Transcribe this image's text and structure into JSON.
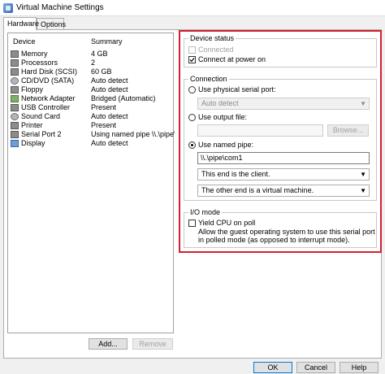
{
  "window": {
    "title": "Virtual Machine Settings"
  },
  "tabs": [
    {
      "label": "Hardware"
    },
    {
      "label": "Options"
    }
  ],
  "devices": {
    "headers": {
      "device": "Device",
      "summary": "Summary"
    },
    "rows": [
      {
        "name": "Memory",
        "summary": "4 GB",
        "icon": "memory-icon"
      },
      {
        "name": "Processors",
        "summary": "2",
        "icon": "processor-icon"
      },
      {
        "name": "Hard Disk (SCSI)",
        "summary": "60 GB",
        "icon": "hard-disk-icon"
      },
      {
        "name": "CD/DVD (SATA)",
        "summary": "Auto detect",
        "icon": "cd-dvd-icon"
      },
      {
        "name": "Floppy",
        "summary": "Auto detect",
        "icon": "floppy-icon"
      },
      {
        "name": "Network Adapter",
        "summary": "Bridged (Automatic)",
        "icon": "network-adapter-icon"
      },
      {
        "name": "USB Controller",
        "summary": "Present",
        "icon": "usb-icon"
      },
      {
        "name": "Sound Card",
        "summary": "Auto detect",
        "icon": "sound-card-icon"
      },
      {
        "name": "Printer",
        "summary": "Present",
        "icon": "printer-icon"
      },
      {
        "name": "Serial Port 2",
        "summary": "Using named pipe \\\\.\\pipe\\co...",
        "icon": "serial-port-icon"
      },
      {
        "name": "Display",
        "summary": "Auto detect",
        "icon": "display-icon"
      }
    ],
    "add_label": "Add...",
    "remove_label": "Remove"
  },
  "device_status": {
    "title": "Device status",
    "connected_label": "Connected",
    "connected_checked": false,
    "connect_power_label": "Connect at power on",
    "connect_power_checked": true
  },
  "connection": {
    "title": "Connection",
    "physical_label": "Use physical serial port:",
    "physical_value": "Auto detect",
    "output_file_label": "Use output file:",
    "browse_label": "Browse...",
    "named_pipe_label": "Use named pipe:",
    "named_pipe_value": "\\\\.\\pipe\\com1",
    "end_option": "This end is the client.",
    "other_end_option": "The other end is a virtual machine.",
    "selected_mode": "named_pipe"
  },
  "io_mode": {
    "title": "I/O mode",
    "yield_label": "Yield CPU on poll",
    "yield_checked": false,
    "description": "Allow the guest operating system to use this serial port in polled mode (as opposed to interrupt mode)."
  },
  "footer": {
    "ok_label": "OK",
    "cancel_label": "Cancel",
    "help_label": "Help"
  },
  "colors": {
    "highlight": "#d3202c",
    "focus": "#0078d7"
  }
}
